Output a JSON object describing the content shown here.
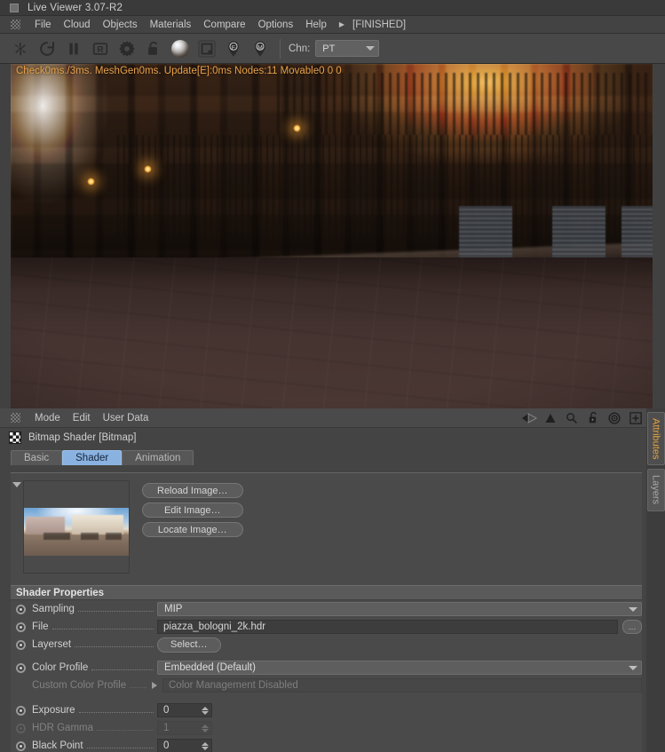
{
  "window": {
    "title": "Live Viewer 3.07-R2",
    "icon": "window-square-icon"
  },
  "menubar": {
    "grip_icon": "drag-grip-icon",
    "items": [
      "File",
      "Cloud",
      "Objects",
      "Materials",
      "Compare",
      "Options",
      "Help"
    ],
    "overflow_icon": "chevron-right-icon",
    "status": "[FINISHED]"
  },
  "toolbar": {
    "buttons": [
      {
        "name": "render-start-button",
        "icon": "fan-render-icon"
      },
      {
        "name": "refresh-button",
        "icon": "circular-arrow-icon"
      },
      {
        "name": "pause-button",
        "icon": "pause-icon"
      },
      {
        "name": "region-render-button",
        "icon": "r-box-icon"
      },
      {
        "name": "settings-button",
        "icon": "gear-icon"
      },
      {
        "name": "lock-button",
        "icon": "padlock-icon"
      },
      {
        "name": "material-preview-button",
        "icon": "sphere-icon"
      },
      {
        "name": "picture-viewer-button",
        "icon": "framed-image-icon"
      },
      {
        "name": "focus-pin-button",
        "icon": "pin-f-icon"
      },
      {
        "name": "material-pin-button",
        "icon": "pin-m-icon"
      }
    ],
    "channel_label": "Chn:",
    "channel_value": "PT",
    "channel_caret_icon": "chevron-down-icon"
  },
  "viewport": {
    "stats_overlay": "Check0ms./3ms. MeshGen0ms. Update[E]:0ms Nodes:11 Movable0  0 0",
    "stats_color": "#e8a24a"
  },
  "attribute_manager": {
    "menu": [
      "Mode",
      "Edit",
      "User Data"
    ],
    "grip_icon": "drag-grip-icon",
    "toolbar_icons": [
      {
        "name": "back-navigate-icon",
        "icon": "left-arrow-icon"
      },
      {
        "name": "up-navigate-icon",
        "icon": "up-arrow-icon"
      },
      {
        "name": "search-icon",
        "icon": "magnifier-icon"
      },
      {
        "name": "lock-attributes-icon",
        "icon": "open-padlock-icon"
      },
      {
        "name": "target-icon",
        "icon": "bullseye-icon"
      },
      {
        "name": "add-tab-icon",
        "icon": "plus-box-icon"
      }
    ],
    "object_icon": "checkerboard-icon",
    "object_title": "Bitmap Shader [Bitmap]",
    "tabs": [
      {
        "label": "Basic",
        "active": false
      },
      {
        "label": "Shader",
        "active": true
      },
      {
        "label": "Animation",
        "active": false
      }
    ],
    "preview": {
      "collapse_icon": "triangle-down-icon",
      "thumbnail_name": "hdri-panorama-thumbnail"
    },
    "image_buttons": [
      {
        "label": "Reload Image…",
        "name": "reload-image-button"
      },
      {
        "label": "Edit Image…",
        "name": "edit-image-button"
      },
      {
        "label": "Locate Image…",
        "name": "locate-image-button"
      }
    ],
    "shader_properties": {
      "section_title": "Shader Properties",
      "rows": [
        {
          "name": "sampling",
          "label": "Sampling",
          "type": "combo",
          "value": "MIP",
          "enabled": true,
          "radio": "on"
        },
        {
          "name": "file",
          "label": "File",
          "type": "text-with-browse",
          "value": "piazza_bologni_2k.hdr",
          "browse_label": "…",
          "enabled": true,
          "radio": "on"
        },
        {
          "name": "layerset",
          "label": "Layerset",
          "type": "button",
          "value": "Select…",
          "enabled": true,
          "radio": "on"
        },
        {
          "name": "color-profile",
          "label": "Color Profile",
          "type": "combo",
          "value": "Embedded (Default)",
          "enabled": true,
          "radio": "on"
        },
        {
          "name": "custom-color-profile",
          "label": "Custom Color Profile",
          "type": "text",
          "value": "Color Management Disabled",
          "enabled": false,
          "radio": "none",
          "sub_arrow_icon": "triangle-right-icon"
        },
        {
          "name": "exposure",
          "label": "Exposure",
          "type": "number",
          "value": "0",
          "enabled": true,
          "radio": "on"
        },
        {
          "name": "hdr-gamma",
          "label": "HDR Gamma",
          "type": "number",
          "value": "1",
          "enabled": false,
          "radio": "off"
        },
        {
          "name": "black-point",
          "label": "Black Point",
          "type": "number",
          "value": "0",
          "enabled": true,
          "radio": "on"
        }
      ]
    },
    "scrollbar": {
      "up_arrow_icon": "triangle-up-icon"
    }
  },
  "side_tabs": [
    {
      "label": "Attributes",
      "active": true
    },
    {
      "label": "Layers",
      "active": false
    }
  ],
  "colors": {
    "accent_orange": "#e8a33d",
    "tab_active_blue": "#8ab2e0",
    "panel_bg": "#444444",
    "toolbar_bg": "#484848"
  }
}
